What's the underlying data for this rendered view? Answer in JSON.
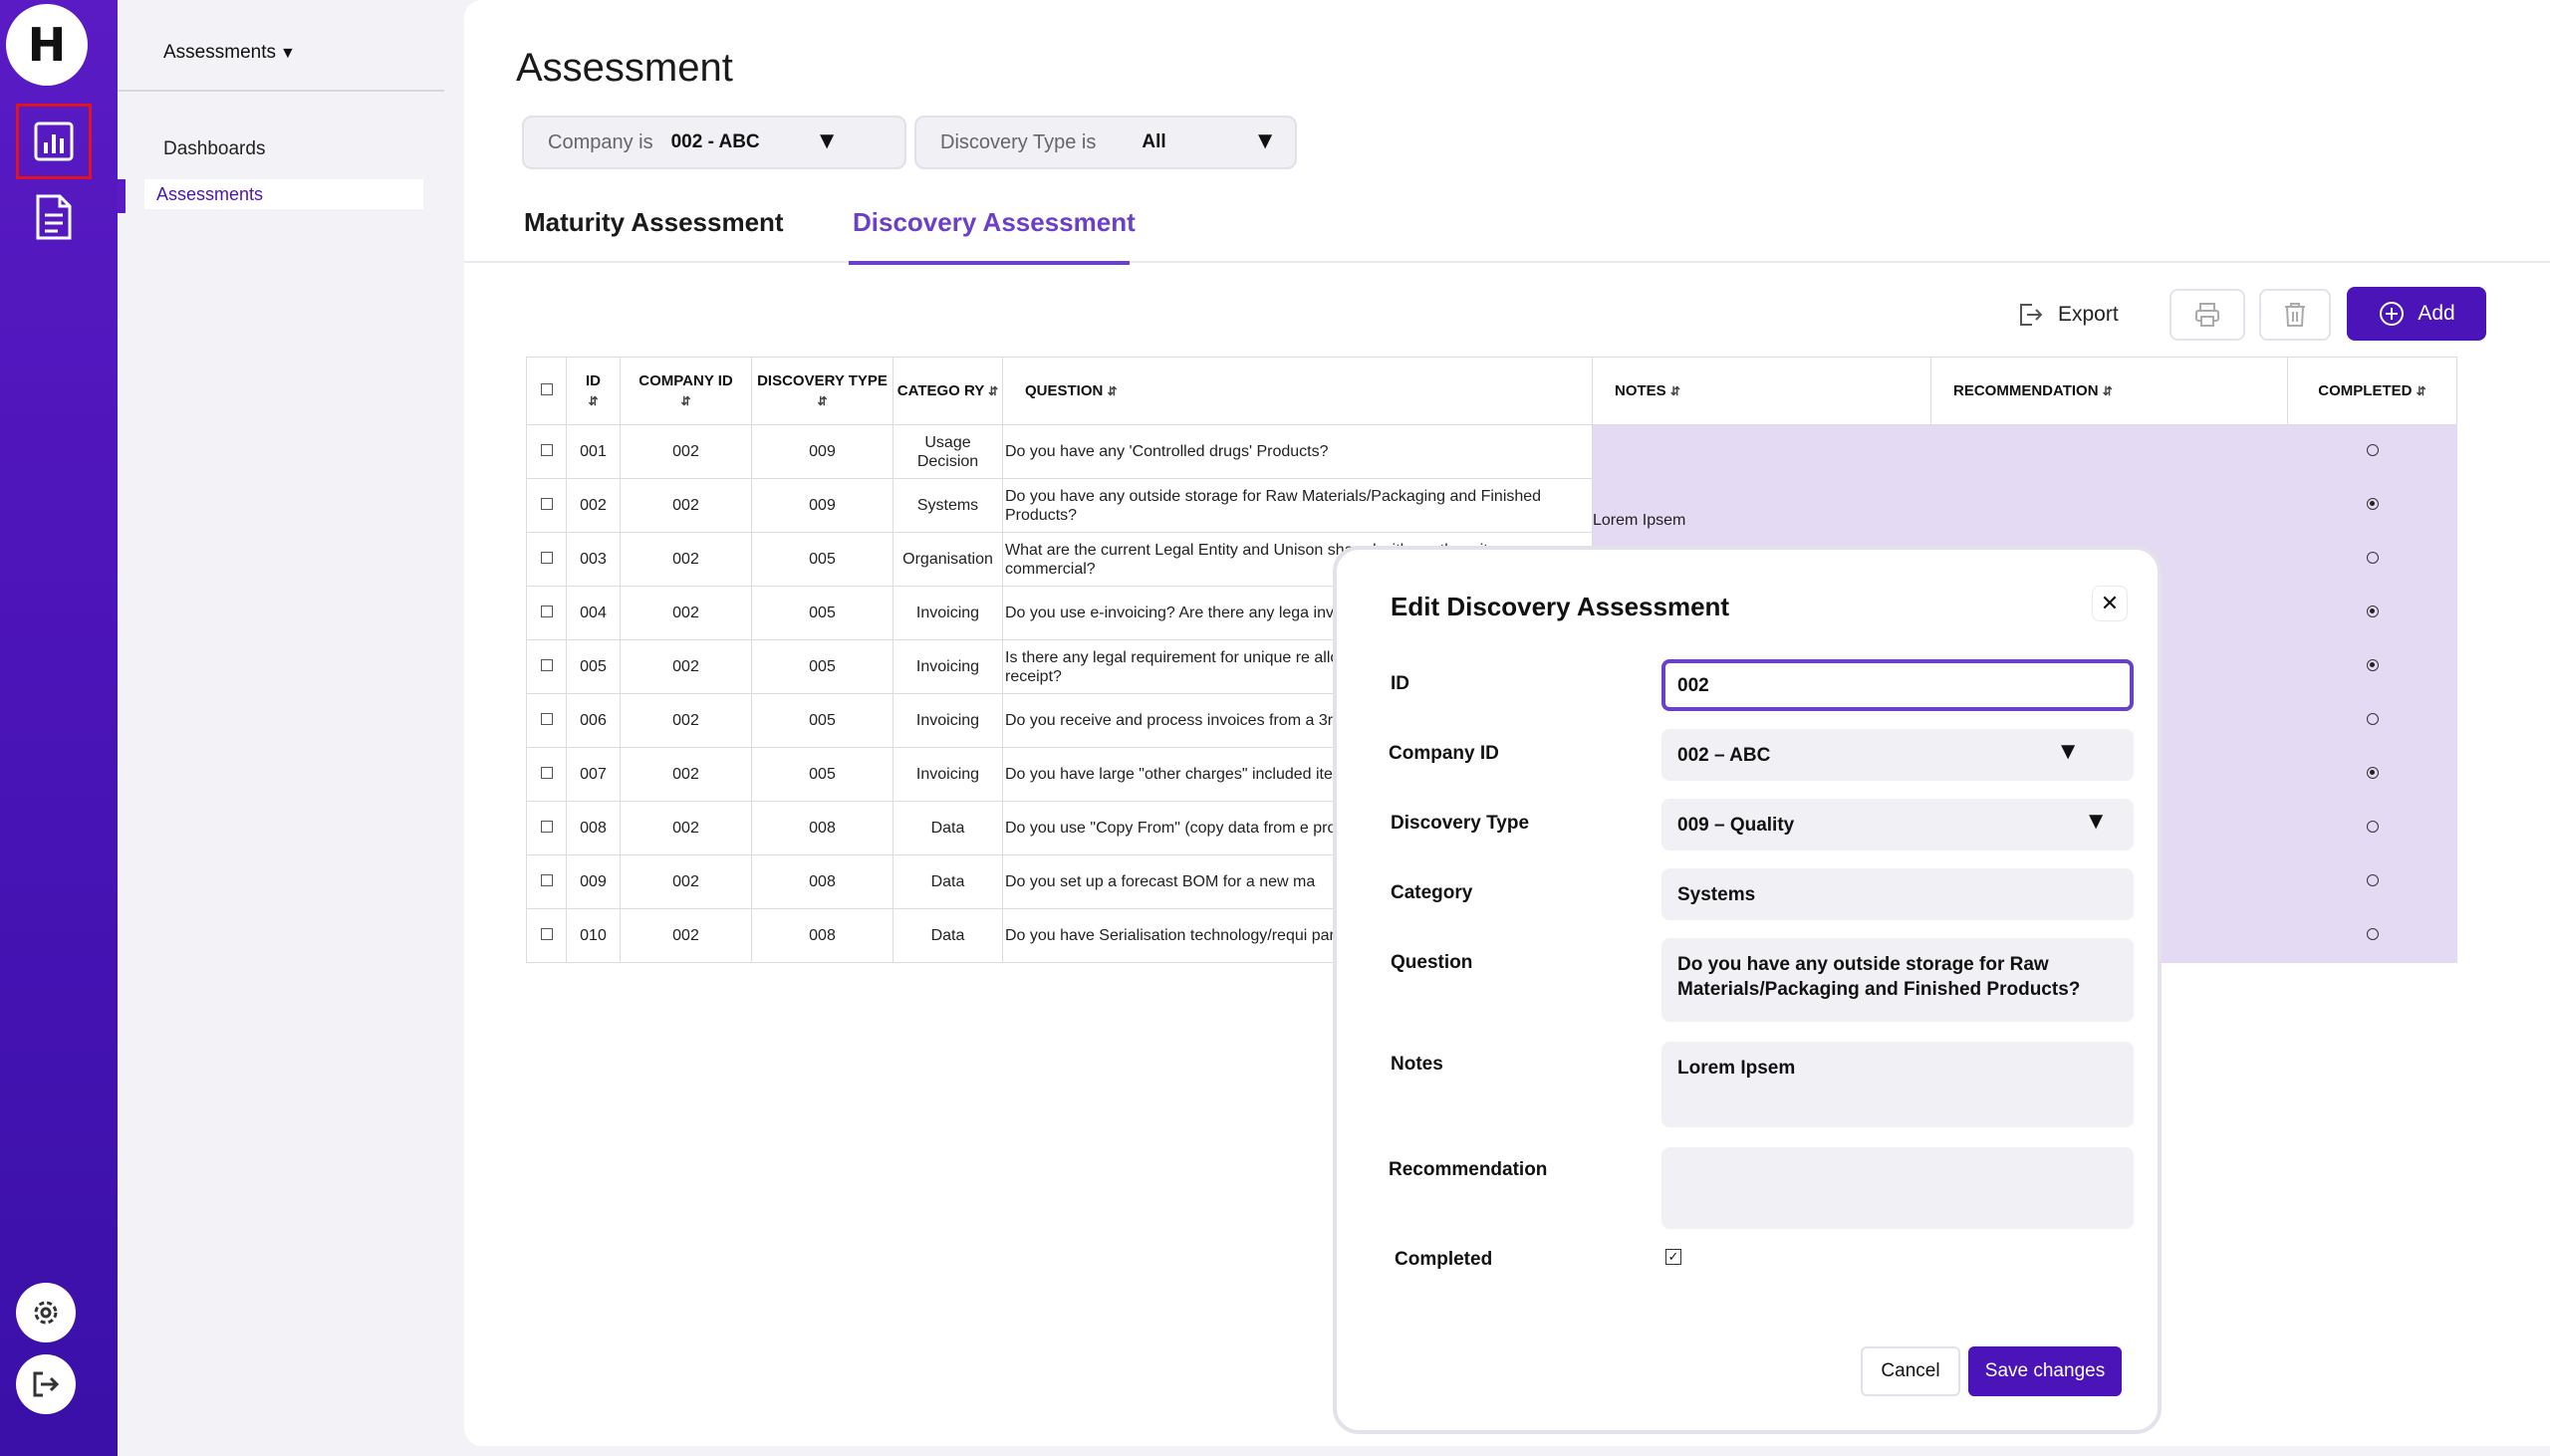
{
  "sidebar": {
    "logo_letter": "H",
    "section_title": "Assessments",
    "items": [
      {
        "label": "Dashboards"
      },
      {
        "label": "Assessments"
      }
    ]
  },
  "page": {
    "title": "Assessment"
  },
  "filters": [
    {
      "label": "Company is",
      "value": "002  - ABC"
    },
    {
      "label": "Discovery Type is",
      "value": "All"
    }
  ],
  "tabs": [
    {
      "label": "Maturity Assessment",
      "active": false
    },
    {
      "label": "Discovery Assessment",
      "active": true
    }
  ],
  "toolbar": {
    "export_label": "Export",
    "add_label": "Add"
  },
  "table": {
    "headers": {
      "id": "ID",
      "company_id": "COMPANY ID",
      "discovery_type": "DISCOVERY TYPE",
      "category": "CATEGO RY",
      "question": "QUESTION",
      "notes": "NOTES",
      "recommendation": "RECOMMENDATION",
      "completed": "COMPLETED"
    },
    "rows": [
      {
        "id": "001",
        "company_id": "002",
        "discovery_type": "009",
        "category": "Usage Decision",
        "question": "Do you have any 'Controlled drugs' Products?",
        "notes": "",
        "recommendation": "",
        "completed": false
      },
      {
        "id": "002",
        "company_id": "002",
        "discovery_type": "009",
        "category": "Systems",
        "question": "Do you have any outside storage for Raw Materials/Packaging and Finished Products?",
        "notes": "Lorem Ipsem",
        "recommendation": "",
        "completed": true
      },
      {
        "id": "003",
        "company_id": "002",
        "discovery_type": "005",
        "category": "Organisation",
        "question": "What are the current Legal Entity and Unison shared with another site or commercial?",
        "notes": "",
        "recommendation": "",
        "completed": false
      },
      {
        "id": "004",
        "company_id": "002",
        "discovery_type": "005",
        "category": "Invoicing",
        "question": "Do you use e-invoicing?  Are there any lega invoicing?",
        "notes": "",
        "recommendation": "",
        "completed": true
      },
      {
        "id": "005",
        "company_id": "002",
        "discovery_type": "005",
        "category": "Invoicing",
        "question": "Is there any legal requirement for unique re allocated to purchase invoices on receipt?",
        "notes": "",
        "recommendation": "",
        "completed": true
      },
      {
        "id": "006",
        "company_id": "002",
        "discovery_type": "005",
        "category": "Invoicing",
        "question": "Do you receive and process invoices from a 3rd parties?",
        "notes": "",
        "recommendation": "",
        "completed": false
      },
      {
        "id": "007",
        "company_id": "002",
        "discovery_type": "005",
        "category": "Invoicing",
        "question": "Do you have large \"other charges\" included items?",
        "notes": "",
        "recommendation": "",
        "completed": true
      },
      {
        "id": "008",
        "company_id": "002",
        "discovery_type": "008",
        "category": "Data",
        "question": "Do you use \"Copy From\" (copy data from e process?",
        "notes": "",
        "recommendation": "",
        "completed": false
      },
      {
        "id": "009",
        "company_id": "002",
        "discovery_type": "008",
        "category": "Data",
        "question": "Do you set up a forecast BOM for a new ma",
        "notes": "",
        "recommendation": "",
        "completed": false
      },
      {
        "id": "010",
        "company_id": "002",
        "discovery_type": "008",
        "category": "Data",
        "question": "Do you have Serialisation technology/requi part of a new pack?",
        "notes": "",
        "recommendation": "",
        "completed": false
      }
    ]
  },
  "modal": {
    "title": "Edit Discovery Assessment",
    "close_symbol": "✕",
    "fields": {
      "id": {
        "label": "ID",
        "value": "002"
      },
      "company_id": {
        "label": "Company ID",
        "value": "002 – ABC"
      },
      "discovery_type": {
        "label": "Discovery Type",
        "value": "009 – Quality"
      },
      "category": {
        "label": "Category",
        "value": "Systems"
      },
      "question": {
        "label": "Question",
        "value": "Do you have any outside storage for Raw Materials/Packaging and Finished Products?"
      },
      "notes": {
        "label": "Notes",
        "value": "Lorem Ipsem"
      },
      "recommendation": {
        "label": "Recommendation",
        "value": ""
      },
      "completed": {
        "label": "Completed",
        "checked": true
      }
    },
    "cancel_label": "Cancel",
    "save_label": "Save changes"
  },
  "icons": {
    "dashboard": "bar-chart-icon",
    "document": "document-icon",
    "settings": "gear-icon",
    "logout": "logout-icon",
    "export": "export-icon",
    "print": "printer-icon",
    "delete": "trash-icon",
    "add": "plus-circle-icon"
  },
  "colors": {
    "brand": "#4b14b8",
    "accent": "#6b3fc7",
    "highlight": "#e5daf3",
    "active_outline": "#e0141e"
  }
}
